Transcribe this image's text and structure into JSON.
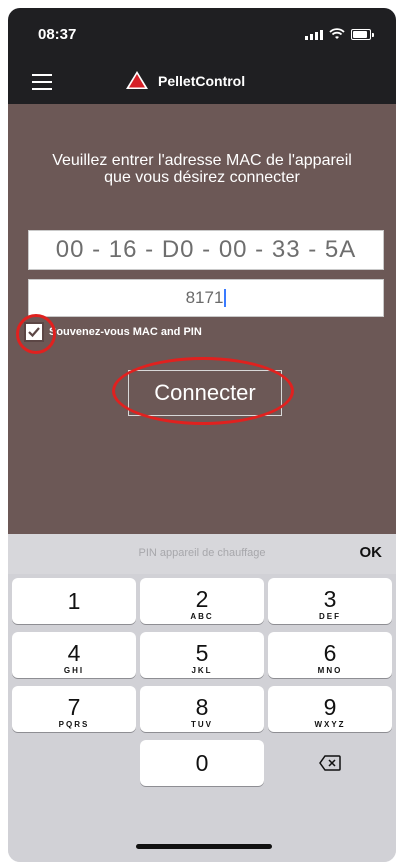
{
  "status": {
    "time": "08:37"
  },
  "navbar": {
    "title": "PelletControl"
  },
  "main": {
    "instruction": "Veuillez entrer l'adresse MAC de l'appareil que vous désirez connecter",
    "mac_value": "00 - 16 - D0 - 00 - 33 - 5A",
    "pin_value": "8171",
    "remember_label": "Souvenez-vous MAC and PIN",
    "remember_checked": true,
    "connect_label": "Connecter"
  },
  "keyboard": {
    "hint": "PIN appareil de chauffage",
    "ok_label": "OK",
    "keys": [
      {
        "digit": "1",
        "letters": ""
      },
      {
        "digit": "2",
        "letters": "ABC"
      },
      {
        "digit": "3",
        "letters": "DEF"
      },
      {
        "digit": "4",
        "letters": "GHI"
      },
      {
        "digit": "5",
        "letters": "JKL"
      },
      {
        "digit": "6",
        "letters": "MNO"
      },
      {
        "digit": "7",
        "letters": "PQRS"
      },
      {
        "digit": "8",
        "letters": "TUV"
      },
      {
        "digit": "9",
        "letters": "WXYZ"
      },
      {
        "digit": "0",
        "letters": ""
      }
    ]
  },
  "colors": {
    "bar": "#1f1f22",
    "main_bg": "#6c5856",
    "annotation_red": "#e0211f",
    "logo_red": "#d62027"
  }
}
